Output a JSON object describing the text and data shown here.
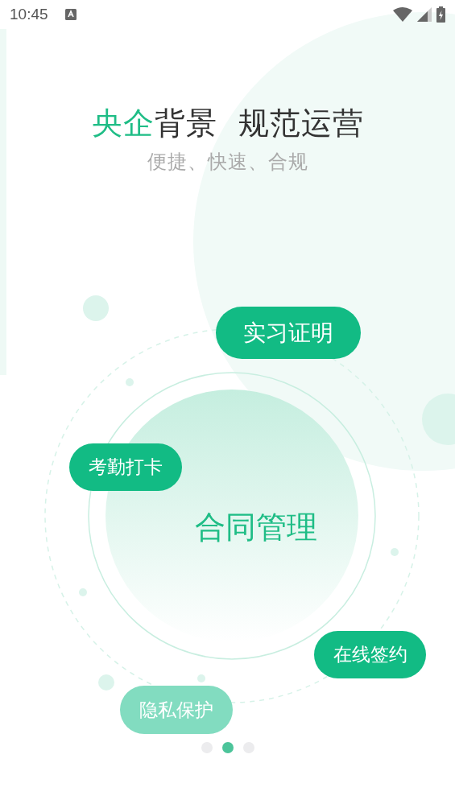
{
  "status_bar": {
    "time": "10:45"
  },
  "headline": [
    {
      "parts": [
        {
          "text": "央企",
          "highlight": true
        },
        {
          "text": "背景",
          "highlight": false
        }
      ]
    },
    {
      "parts": [
        {
          "text": "规范运营",
          "highlight": false
        }
      ]
    }
  ],
  "subtitle": "便捷、快速、合规",
  "center_label": "合同管理",
  "features": [
    {
      "label": "实习证明",
      "faded": false
    },
    {
      "label": "考勤打卡",
      "faded": false
    },
    {
      "label": "在线签约",
      "faded": false
    },
    {
      "label": "隐私保护",
      "faded": true
    }
  ],
  "pager": [
    {
      "selected": false
    },
    {
      "selected": true
    },
    {
      "selected": false
    }
  ]
}
